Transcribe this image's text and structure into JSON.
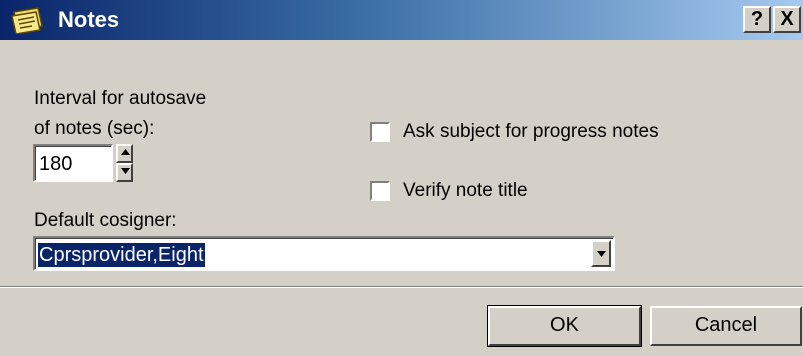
{
  "window": {
    "title": "Notes",
    "help_label": "?",
    "close_label": "X"
  },
  "autosave": {
    "label_line1": "Interval for autosave",
    "label_line2": "of notes (sec):",
    "value": "180"
  },
  "options": {
    "ask_subject_label": "Ask subject for progress notes",
    "ask_subject_checked": false,
    "verify_title_label": "Verify note title",
    "verify_title_checked": false
  },
  "cosigner": {
    "label": "Default cosigner:",
    "selected": "Cprsprovider,Eight"
  },
  "buttons": {
    "ok": "OK",
    "cancel": "Cancel"
  },
  "colors": {
    "title_bar_start": "#0a246a",
    "title_bar_end": "#a6caf0",
    "dialog_face": "#d4d0c8",
    "selection": "#0a246a"
  },
  "icons": {
    "title": "notes-icon",
    "spin_up": "arrow-up-icon",
    "spin_down": "arrow-down-icon",
    "dropdown": "chevron-down-icon"
  }
}
